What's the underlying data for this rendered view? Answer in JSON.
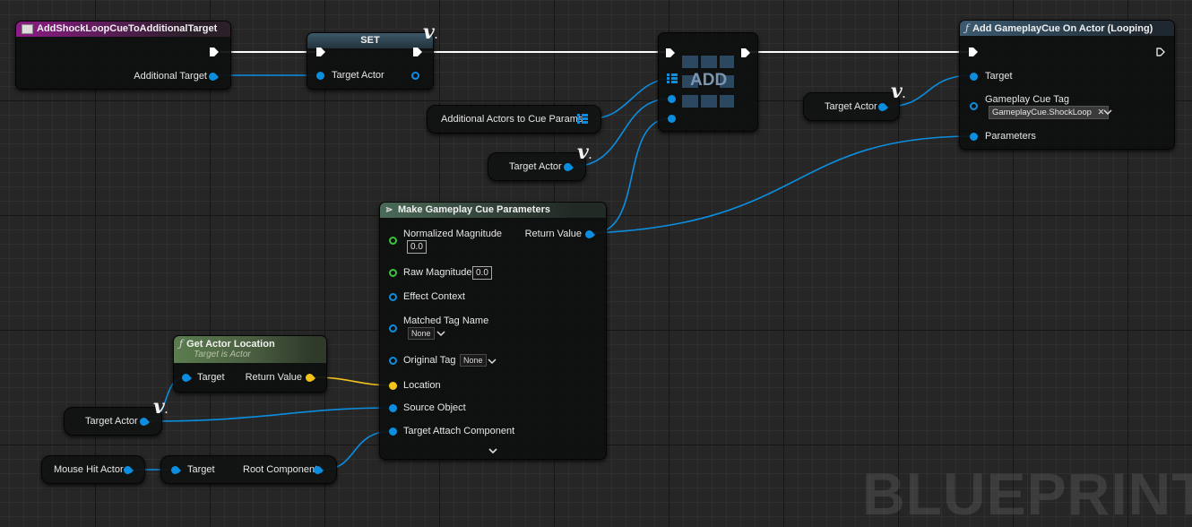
{
  "watermark": "BLUEPRINT",
  "event_node": {
    "title": "AddShockLoopCueToAdditionalTarget",
    "pin_additional_target": "Additional Target"
  },
  "set_node": {
    "title": "SET",
    "pin_target_actor": "Target Actor"
  },
  "array_add_node": {
    "label": "ADD"
  },
  "add_cue_node": {
    "title": "Add GameplayCue On Actor (Looping)",
    "pin_target": "Target",
    "pin_gameplay_cue_tag": "Gameplay Cue Tag",
    "tag_value": "GameplayCue.ShockLoop",
    "pin_parameters": "Parameters"
  },
  "var_target_actor_1": "Target Actor",
  "var_additional_actors": "Additional Actors to Cue Params",
  "var_target_actor_2": "Target Actor",
  "var_target_actor_3": "Target Actor",
  "var_mouse_hit_actor": "Mouse Hit Actor",
  "make_params_node": {
    "title": "Make Gameplay Cue Parameters",
    "pin_normalized_magnitude": "Normalized Magnitude",
    "normalized_magnitude_value": "0.0",
    "pin_raw_magnitude": "Raw Magnitude",
    "raw_magnitude_value": "0.0",
    "pin_effect_context": "Effect Context",
    "pin_matched_tag_name": "Matched Tag Name",
    "matched_tag_value": "None",
    "pin_original_tag": "Original Tag",
    "original_tag_value": "None",
    "pin_location": "Location",
    "pin_source_object": "Source Object",
    "pin_target_attach_component": "Target Attach Component",
    "pin_return_value": "Return Value"
  },
  "get_location_node": {
    "title": "Get Actor Location",
    "subtitle": "Target is Actor",
    "pin_target": "Target",
    "pin_return_value": "Return Value"
  },
  "root_component_node": {
    "pin_target": "Target",
    "pin_root_component": "Root Component"
  },
  "colors": {
    "object_pin": "#0c8ee0",
    "vector_pin": "#f4c41a",
    "float_pin": "#3bc43b",
    "exec_wire": "#ffffff",
    "event_header": "#8c1c86",
    "function_header": "#3b5a70",
    "pure_function_header": "#5c7d4f"
  }
}
